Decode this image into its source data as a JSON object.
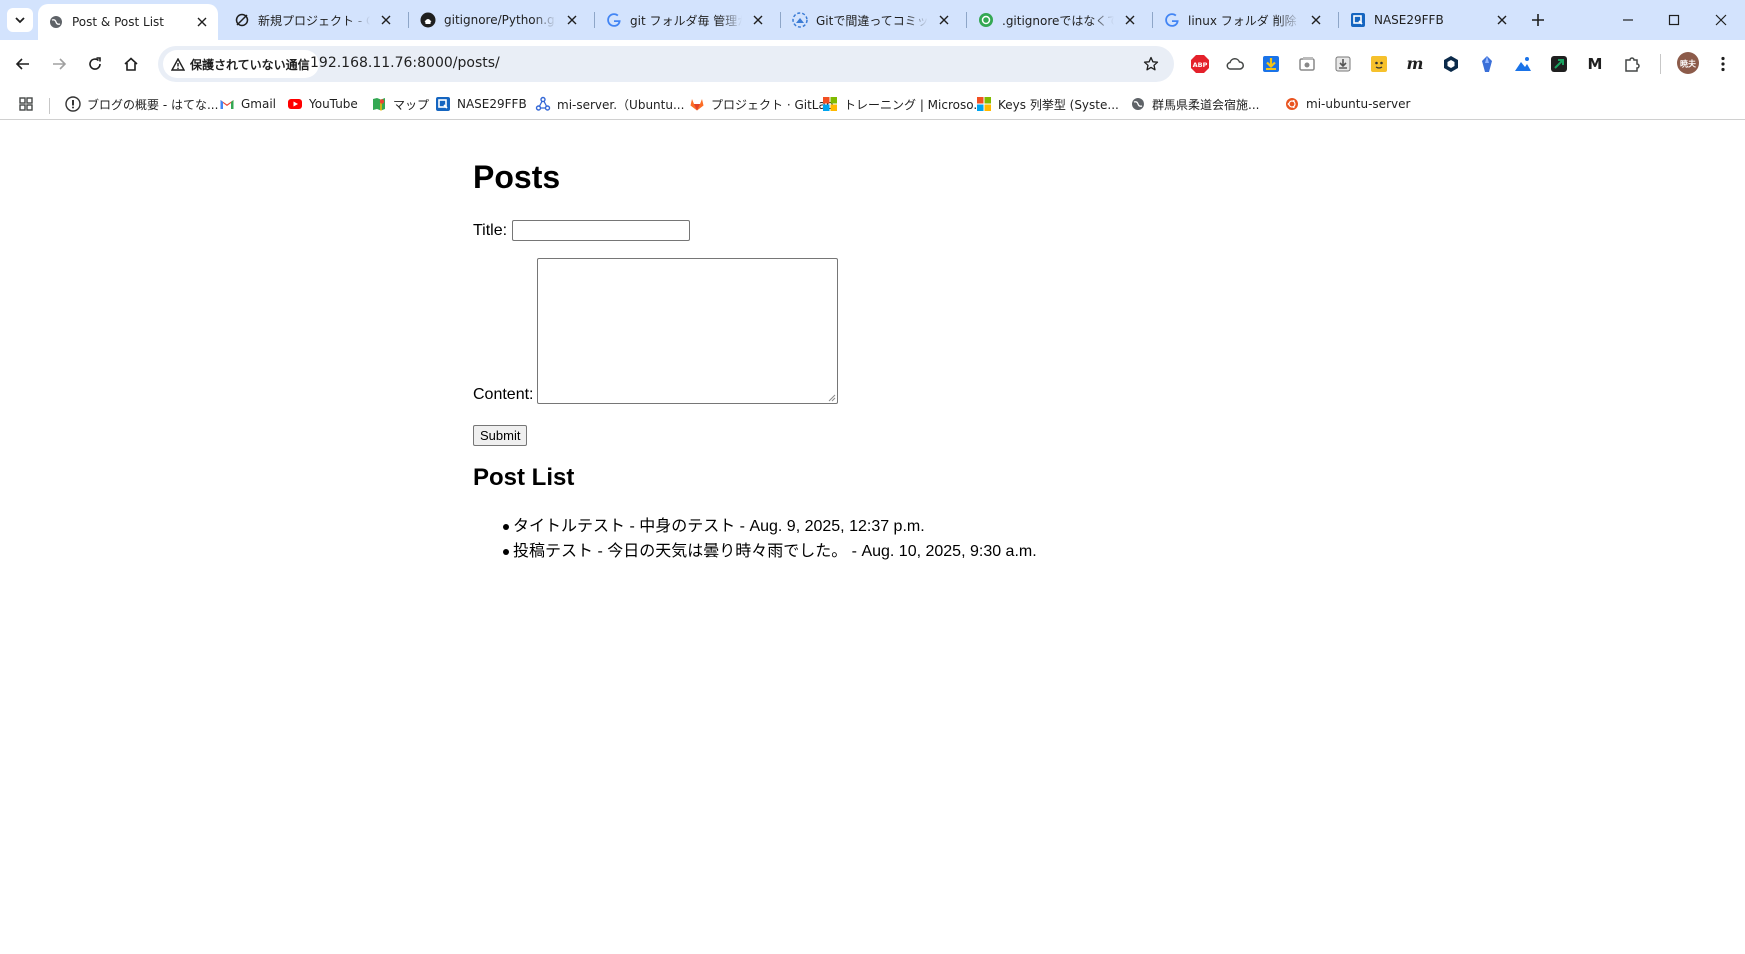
{
  "tabs": [
    {
      "title": "Post & Post List",
      "icon": "globe-icon",
      "active": true
    },
    {
      "title": "新規プロジェクト - Grok",
      "icon": "grok-icon",
      "active": false
    },
    {
      "title": "gitignore/Python.gitignore",
      "icon": "github-icon",
      "active": false
    },
    {
      "title": "git フォルダ毎 管理から外す",
      "icon": "google-icon",
      "active": false
    },
    {
      "title": "Gitで間違ってコミットした",
      "icon": "cloud-upload-icon",
      "active": false
    },
    {
      "title": ".gitignoreではなくて、管理",
      "icon": "chatgpt-icon",
      "active": false
    },
    {
      "title": "linux フォルダ 削除 - Google",
      "icon": "google-icon",
      "active": false
    },
    {
      "title": "NASE29FFB",
      "icon": "qnap-icon",
      "active": false
    }
  ],
  "toolbar": {
    "security_label": "保護されていない通信",
    "url": "192.168.11.76:8000/posts/",
    "profile_initials": "暁夫"
  },
  "extensions": [
    {
      "name": "adblock-plus-icon",
      "text": "ABP",
      "color": "#e4212b"
    },
    {
      "name": "cloud-icon",
      "text": "",
      "color": "#444746"
    },
    {
      "name": "download-arrow-icon",
      "text": "",
      "color": "#f5a623"
    },
    {
      "name": "screen-capture-icon",
      "text": "",
      "color": "#888888"
    },
    {
      "name": "download-tray-icon",
      "text": "",
      "color": "#666666"
    },
    {
      "name": "sticky-face-icon",
      "text": "",
      "color": "#f6c12c"
    },
    {
      "name": "m-italic-icon",
      "text": "m",
      "color": "#1f1f1f"
    },
    {
      "name": "hexagon-icon",
      "text": "",
      "color": "#0b2a4a"
    },
    {
      "name": "crystal-icon",
      "text": "",
      "color": "#3a6fd8"
    },
    {
      "name": "image-mountain-icon",
      "text": "",
      "color": "#1a73e8"
    },
    {
      "name": "green-square-icon",
      "text": "",
      "color": "#1aa260"
    },
    {
      "name": "m-bold-icon",
      "text": "M",
      "color": "#1f1f1f"
    },
    {
      "name": "puzzle-icon",
      "text": "",
      "color": "#444746"
    }
  ],
  "bookmarks": [
    {
      "label": "ブログの概要 - はてな...",
      "icon": "hatena-icon"
    },
    {
      "label": "Gmail",
      "icon": "gmail-icon"
    },
    {
      "label": "YouTube",
      "icon": "youtube-icon"
    },
    {
      "label": "マップ",
      "icon": "maps-icon"
    },
    {
      "label": "NASE29FFB",
      "icon": "qnap-icon"
    },
    {
      "label": "mi-server.（Ubuntu...",
      "icon": "network-icon"
    },
    {
      "label": "プロジェクト · GitLab",
      "icon": "gitlab-icon"
    },
    {
      "label": "トレーニング | Microso...",
      "icon": "microsoft-icon"
    },
    {
      "label": "Keys 列挙型 (Syste...",
      "icon": "microsoft-icon"
    },
    {
      "label": "群馬県柔道会宿施...",
      "icon": "globe-icon"
    },
    {
      "label": "mi-ubuntu-server",
      "icon": "ubuntu-icon"
    }
  ],
  "page": {
    "heading": "Posts",
    "title_label": "Title:",
    "title_value": "",
    "content_label": "Content:",
    "content_value": "",
    "submit_label": "Submit",
    "list_heading": "Post List",
    "posts": [
      "タイトルテスト - 中身のテスト - Aug. 9, 2025, 12:37 p.m.",
      "投稿テスト - 今日の天気は曇り時々雨でした。 - Aug. 10, 2025, 9:30 a.m."
    ]
  }
}
